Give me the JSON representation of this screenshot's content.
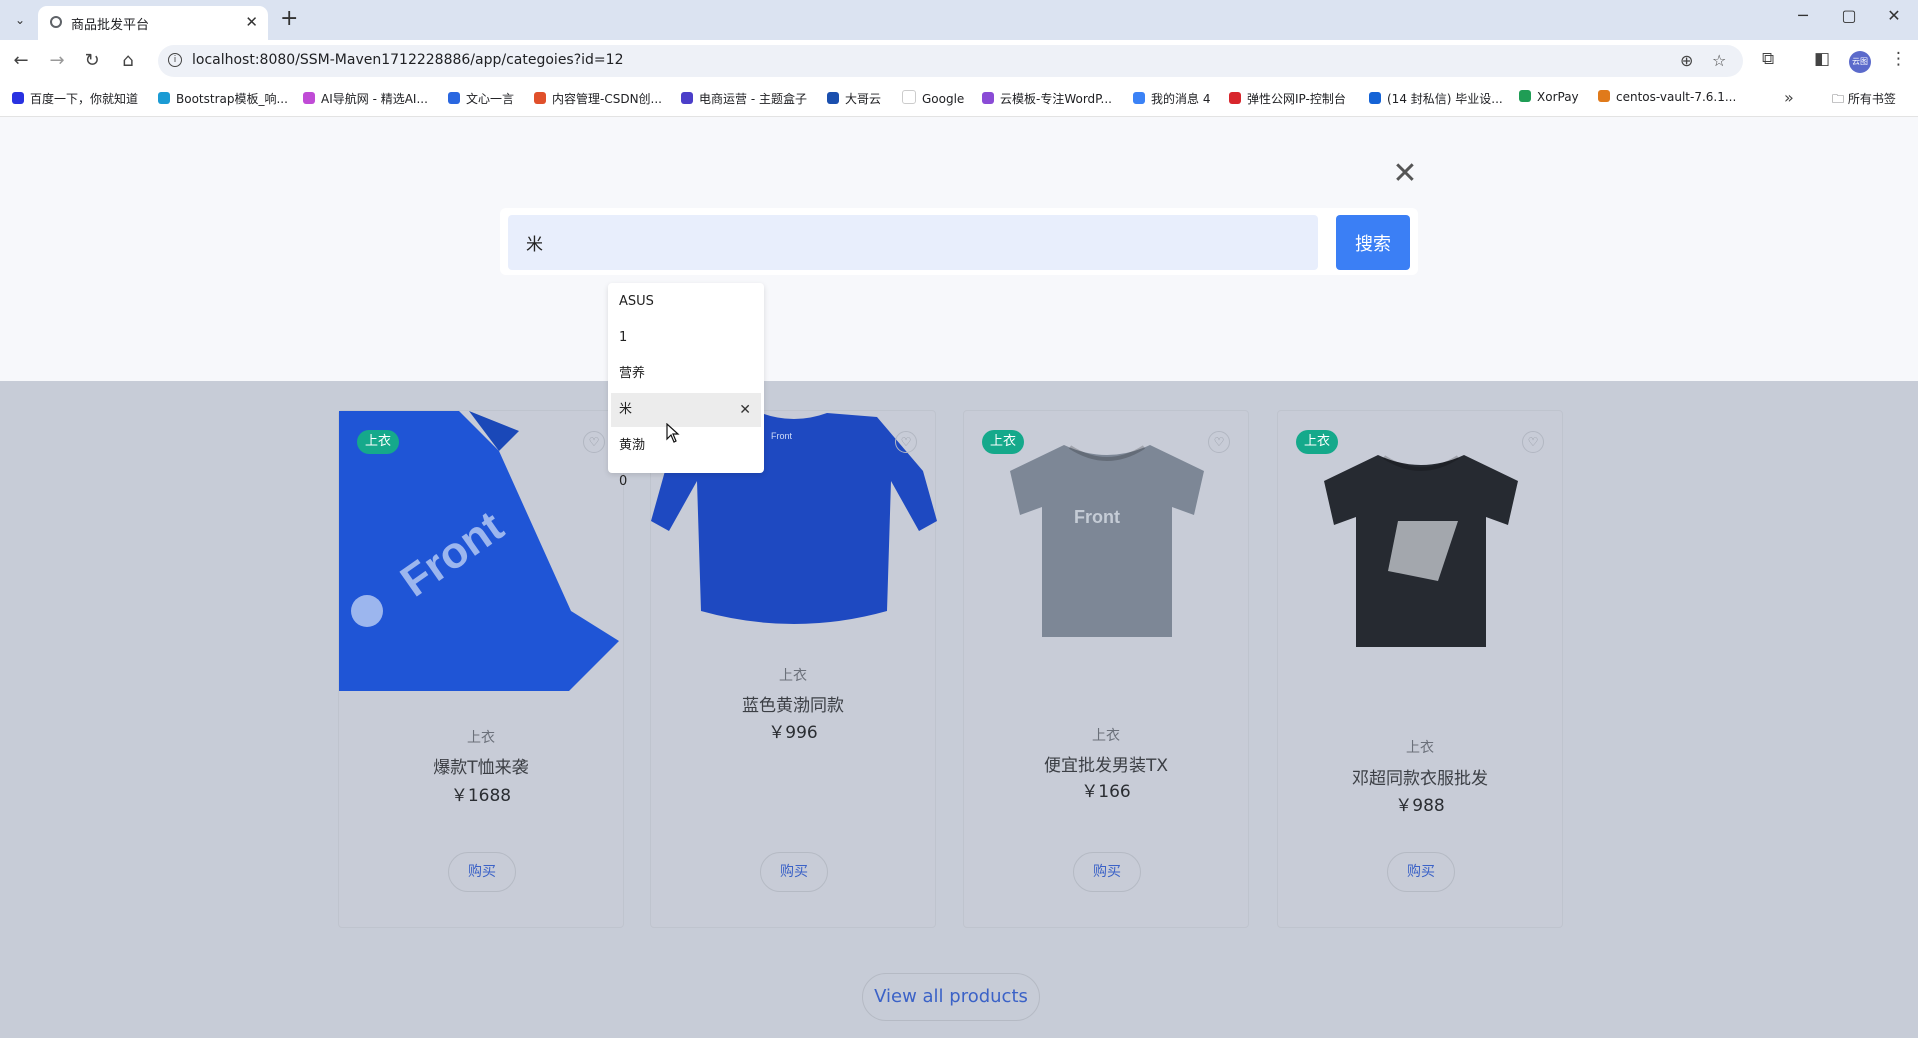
{
  "browser": {
    "tab_title": "商品批发平台",
    "tab_close": "✕",
    "new_tab": "+",
    "tab_menu": "⌄",
    "window_controls": {
      "minimize": "─",
      "maximize": "▢",
      "close": "✕"
    },
    "nav": {
      "back": "←",
      "forward": "→",
      "reload": "↻",
      "home": "⌂"
    },
    "url": "localhost:8080/SSM-Maven1712228886/app/categoies?id=12",
    "info_icon": "i",
    "zoom_icon": "⊕",
    "star_icon": "☆",
    "extensions_icon": "⧉",
    "sidebar_icon": "◧",
    "profile_label": "云图",
    "menu_icon": "⋮",
    "bookmarks": [
      {
        "label": "百度一下，你就知道",
        "color": "#2932e1"
      },
      {
        "label": "Bootstrap模板_响...",
        "color": "#1b9bd4"
      },
      {
        "label": "AI导航网 - 精选AI...",
        "color": "#c04bd6"
      },
      {
        "label": "文心一言",
        "color": "#2a67e0"
      },
      {
        "label": "内容管理-CSDN创...",
        "color": "#e0502b"
      },
      {
        "label": "电商运营 - 主题盒子",
        "color": "#4b3ec9"
      },
      {
        "label": "大哥云",
        "color": "#1a4fae"
      },
      {
        "label": "Google",
        "color": "#ffffff"
      },
      {
        "label": "云模板-专注WordP...",
        "color": "#8a4bd6"
      },
      {
        "label": "我的消息 4",
        "color": "#3b82f6"
      },
      {
        "label": "弹性公网IP-控制台",
        "color": "#d8262c"
      },
      {
        "label": "(14 封私信) 毕业设...",
        "color": "#1463d6"
      },
      {
        "label": "XorPay",
        "color": "#1f9d55"
      },
      {
        "label": "centos-vault-7.6.1...",
        "color": "#e07a1b"
      }
    ],
    "bookmarks_more": "»",
    "all_bookmarks": "所有书签"
  },
  "search": {
    "close_icon": "✕",
    "input_value": "米",
    "button_label": "搜索",
    "suggestions": [
      "ASUS",
      "1",
      "营养",
      "米",
      "黄渤",
      "0"
    ],
    "active_suggestion_index": 3,
    "delete_icon": "✕"
  },
  "products": [
    {
      "badge": "上衣",
      "category": "上衣",
      "name": "爆款T恤来袭",
      "price": "￥1688",
      "buy": "购买",
      "color": "#1f55d6",
      "style": "folded"
    },
    {
      "badge": "上衣",
      "category": "上衣",
      "name": "蓝色黄渤同款",
      "price": "￥996",
      "buy": "购买",
      "color": "#1e49c1",
      "style": "sweater"
    },
    {
      "badge": "上衣",
      "category": "上衣",
      "name": "便宜批发男装TX",
      "price": "￥166",
      "buy": "购买",
      "color": "#7d8796",
      "style": "tee"
    },
    {
      "badge": "上衣",
      "category": "上衣",
      "name": "邓超同款衣服批发",
      "price": "￥988",
      "buy": "购买",
      "color": "#262a31",
      "style": "tee-dark"
    }
  ],
  "brand_print": "Front",
  "view_all": "View all products"
}
